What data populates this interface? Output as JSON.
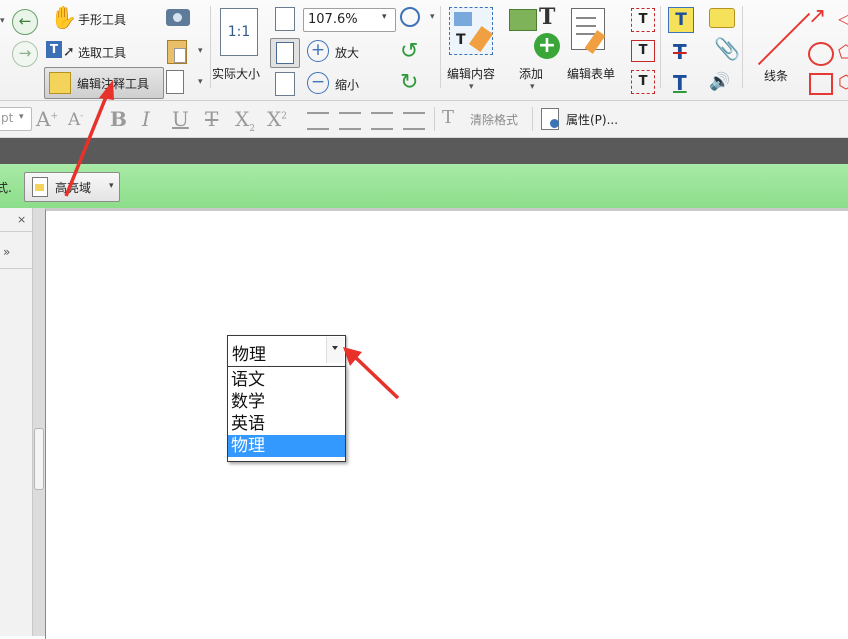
{
  "toolbar": {
    "hand_tool": "手形工具",
    "select_tool": "选取工具",
    "edit_annotation_tool": "编辑注释工具",
    "actual_size": "实际大小",
    "zoom_value": "107.6%",
    "zoom_in": "放大",
    "zoom_out": "缩小",
    "edit_content": "编辑内容",
    "add": "添加",
    "edit_form": "编辑表单",
    "lines": "线条",
    "font_size_fragment": "pt",
    "clear_format": "清除格式",
    "properties": "属性(P)..."
  },
  "secondary": {
    "left_fragment": "式.",
    "highlight_field": "高亮域"
  },
  "form_field": {
    "selected_value": "物理",
    "options": [
      "语文",
      "数学",
      "英语",
      "物理"
    ],
    "selected_index": 3
  },
  "colors": {
    "green_bar": "#8cdd8a",
    "selection": "#3399ff",
    "annotation_arrow": "#e8312a"
  }
}
